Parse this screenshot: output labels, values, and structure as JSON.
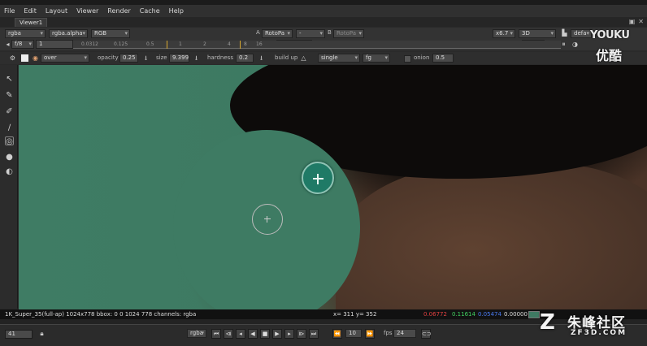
{
  "menu": [
    "File",
    "Edit",
    "Layout",
    "Viewer",
    "Render",
    "Cache",
    "Help"
  ],
  "tab": {
    "label": "Viewer1"
  },
  "toolbar1": {
    "channel_set": "rgba",
    "channel_alpha": "rgba.alpha",
    "display": "RGB",
    "input_a_label": "A",
    "input_a": "RotoPa",
    "compare": "-",
    "input_b_label": "B",
    "input_b": "RotoPa",
    "zoom": "x6.7",
    "view": "3D",
    "viewer_process": "defa"
  },
  "toolbar2": {
    "fstop": "f/8",
    "gain": "1",
    "frame_label": "Y",
    "frame": "1",
    "ruler_ticks": [
      "0.0312",
      "0.125",
      "0.5",
      "1",
      "2",
      "4",
      "8",
      "16"
    ],
    "proxy": "1"
  },
  "toolbar3": {
    "mode": "over",
    "opacity_label": "opacity",
    "opacity": "0.25",
    "size_label": "size",
    "size": "9.399",
    "hardness_label": "hardness",
    "hardness": "0.2",
    "buildup_label": "build up",
    "lifetime": "single",
    "target": "fg",
    "onion_label": "onion",
    "onion": "0.5"
  },
  "status": {
    "format": "1K_Super_35(full-ap) 1024x778  bbox: 0 0 1024 778 channels: rgba",
    "xy": "x= 311 y= 352",
    "r": "0.06772",
    "g": "0.11614",
    "b": "0.05474",
    "a": "0.00000",
    "swatch_color": "#3f7a63"
  },
  "timeline": {
    "frame": "41",
    "mode": "rgba",
    "skip": "10",
    "fps_label": "fps",
    "fps": "24"
  },
  "watermarks": {
    "youku_en": "YOUKU",
    "youku_cn": "优酷",
    "site_cn": "朱峰社区",
    "site_url": "ZF3D.COM"
  },
  "icons": [
    "pointer-icon",
    "bezier-icon",
    "brush-icon",
    "eraser-icon",
    "clone-icon",
    "blur-icon",
    "dodge-icon"
  ]
}
